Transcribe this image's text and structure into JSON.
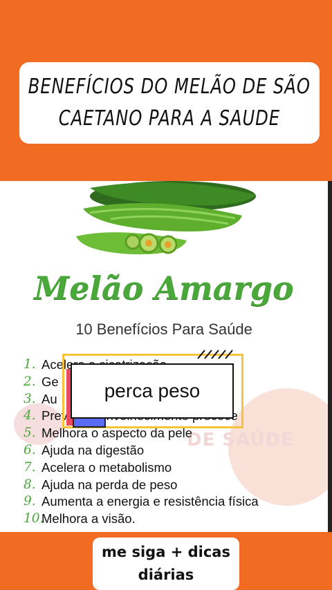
{
  "header": {
    "line1": "BENEFÍCIOS DO MELÃO DE SÃO",
    "line2": "CAETANO PARA A SAUDE"
  },
  "content": {
    "title": "Melão Amargo",
    "subtitle": "10 Benefícios Para Saúde",
    "watermark": "DE SAÚDE",
    "benefits": [
      {
        "num": "1.",
        "text": "Acelera a cicatrização"
      },
      {
        "num": "2.",
        "text": "Ge"
      },
      {
        "num": "3.",
        "text": "Au"
      },
      {
        "num": "4.",
        "text": "Previne o envelhecimento precoce"
      },
      {
        "num": "5.",
        "text": "Melhora o aspecto da pele"
      },
      {
        "num": "6.",
        "text": "Ajuda na digestão"
      },
      {
        "num": "7.",
        "text": "Acelera o metabolismo"
      },
      {
        "num": "8.",
        "text": "Ajuda na perda de peso"
      },
      {
        "num": "9.",
        "text": "Aumenta a energia e resistência física"
      },
      {
        "num": "10.",
        "text": "Melhora a visão."
      }
    ]
  },
  "overlay": {
    "caption": "perca peso"
  },
  "cta": {
    "line1": "me siga + dicas",
    "line2": "diárias"
  },
  "colors": {
    "background": "#f26b22",
    "title_green": "#4aa83a",
    "yellow": "#f7c33b",
    "red": "#ea4b5f",
    "blue": "#5b6cf2"
  }
}
